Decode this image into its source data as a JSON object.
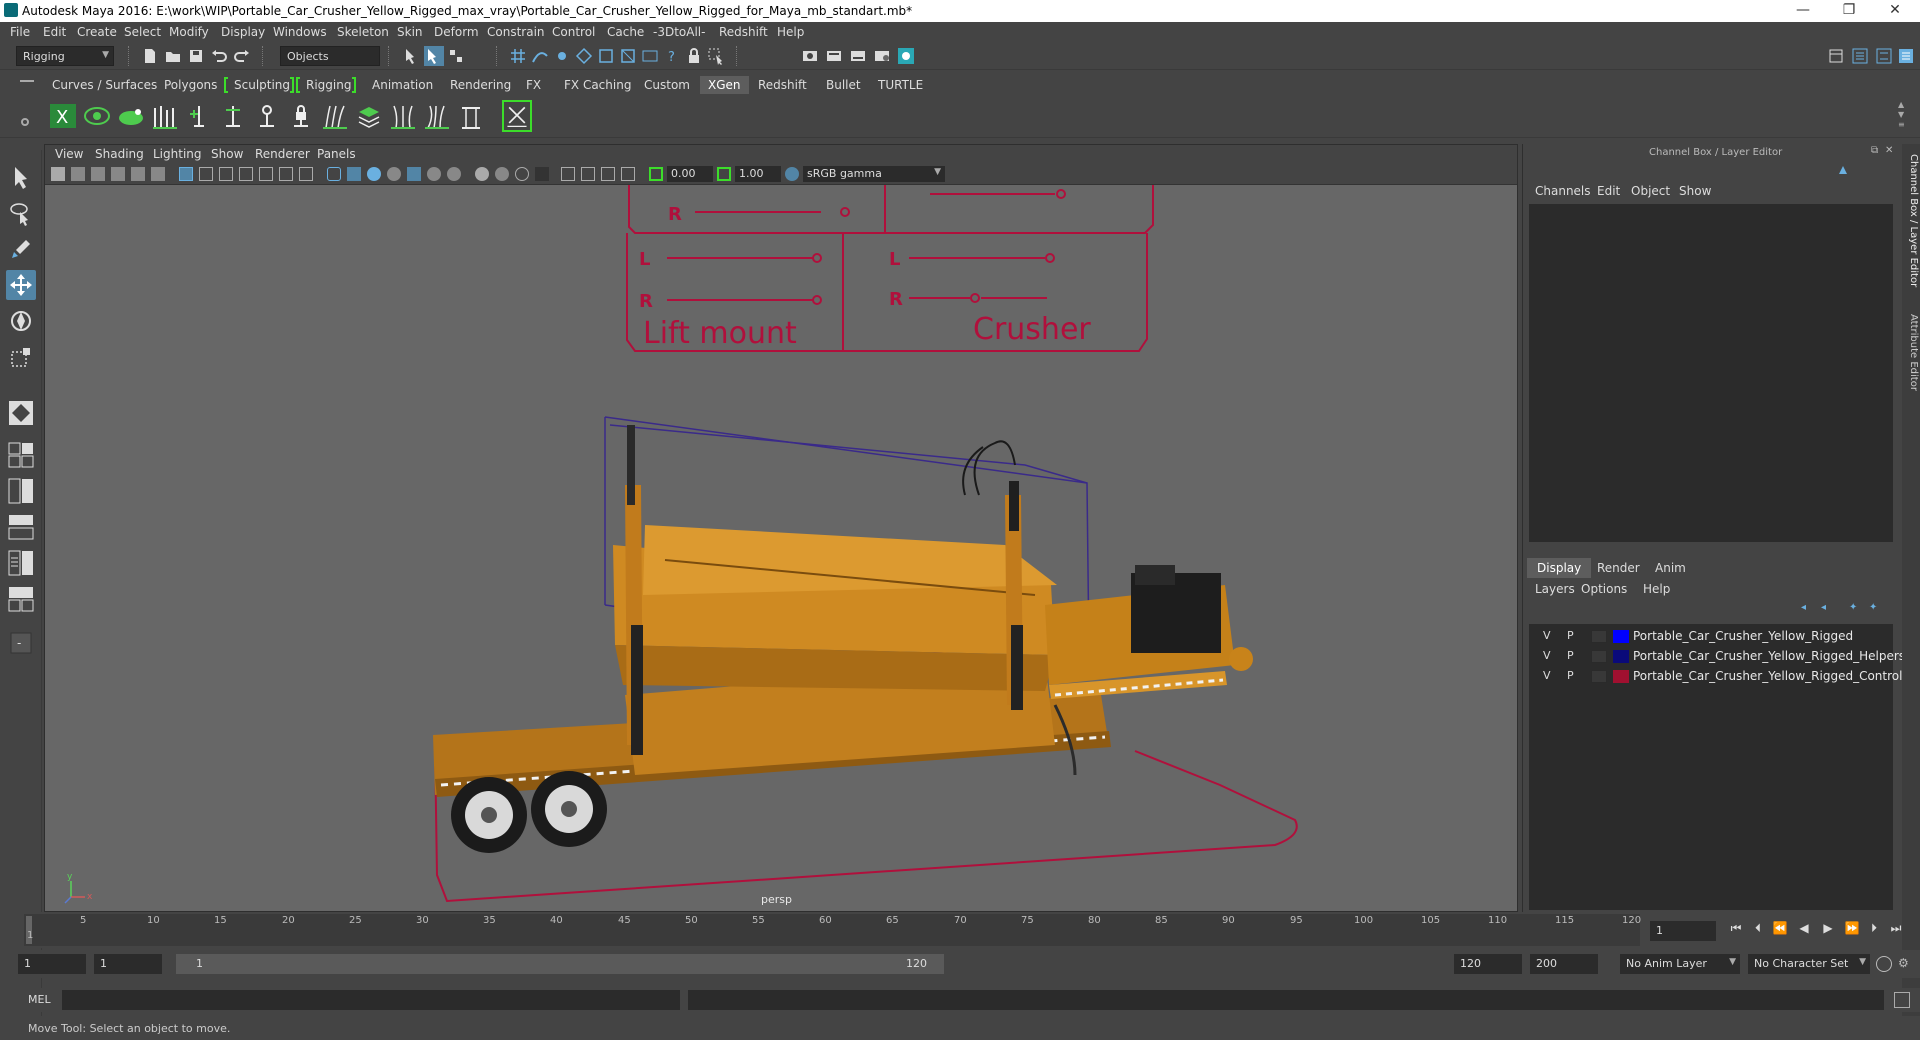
{
  "window": {
    "title": "Autodesk Maya 2016: E:\\work\\WIP\\Portable_Car_Crusher_Yellow_Rigged_max_vray\\Portable_Car_Crusher_Yellow_Rigged_for_Maya_mb_standart.mb*",
    "minimize": "—",
    "restore": "❐",
    "close": "✕"
  },
  "menubar": [
    "File",
    "Edit",
    "Create",
    "Select",
    "Modify",
    "Display",
    "Windows",
    "Skeleton",
    "Skin",
    "Deform",
    "Constrain",
    "Control",
    "Cache",
    "-3DtoAll-",
    "Redshift",
    "Help"
  ],
  "statusline": {
    "mode": "Rigging",
    "selection_mode": "Objects"
  },
  "shelf": {
    "tabs": [
      "Curves / Surfaces",
      "Polygons",
      "Sculpting",
      "Rigging",
      "Animation",
      "Rendering",
      "FX",
      "FX Caching",
      "Custom",
      "XGen",
      "Redshift",
      "Bullet",
      "TURTLE"
    ],
    "active_tab": "XGen"
  },
  "viewport": {
    "menu": [
      "View",
      "Shading",
      "Lighting",
      "Show",
      "Renderer",
      "Panels"
    ],
    "exposure": "0.00",
    "gamma": "1.00",
    "colorspace": "sRGB gamma",
    "camera": "persp",
    "scene": {
      "ctrl_R1": "R",
      "ctrl_L2": "L",
      "ctrl_R2": "R",
      "ctrl_L3": "L",
      "ctrl_R3": "R",
      "label_lift": "Lift mount",
      "label_crusher": "Crusher",
      "axis_y": "y",
      "axis_x": "x"
    },
    "accent_rig": "#b0103c",
    "accent_model": "#c8831a"
  },
  "right_panel": {
    "header": "Channel Box / Layer Editor",
    "menu": [
      "Channels",
      "Edit",
      "Object",
      "Show"
    ],
    "tabs": [
      "Display",
      "Render",
      "Anim"
    ],
    "active_tab": "Display",
    "submenu": [
      "Layers",
      "Options",
      "Help"
    ],
    "layers": [
      {
        "v": "V",
        "p": "P",
        "name": "Portable_Car_Crusher_Yellow_Rigged",
        "color": "#0000ff"
      },
      {
        "v": "V",
        "p": "P",
        "name": "Portable_Car_Crusher_Yellow_Rigged_Helpers",
        "color": "#0a0a7a"
      },
      {
        "v": "V",
        "p": "P",
        "name": "Portable_Car_Crusher_Yellow_Rigged_Controllers",
        "color": "#a01030"
      }
    ]
  },
  "side_tabs": [
    "Channel Box / Layer Editor",
    "Attribute Editor"
  ],
  "timeline": {
    "ticks": [
      "1",
      "5",
      "10",
      "15",
      "20",
      "25",
      "30",
      "35",
      "40",
      "45",
      "50",
      "55",
      "60",
      "65",
      "70",
      "75",
      "80",
      "85",
      "90",
      "95",
      "100",
      "105",
      "110",
      "115",
      "120"
    ],
    "current_frame": "1"
  },
  "range": {
    "start": "1",
    "playback_start": "1",
    "slider_start": "1",
    "slider_end": "120",
    "playback_end": "120",
    "end": "200",
    "anim_layer": "No Anim Layer",
    "char_set": "No Character Set"
  },
  "cmdline": {
    "label": "MEL"
  },
  "helpline": {
    "text": "Move Tool: Select an object to move."
  }
}
